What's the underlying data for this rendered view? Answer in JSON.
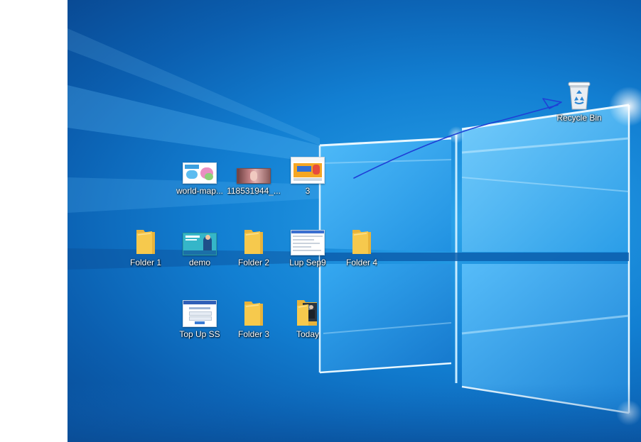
{
  "desktop": {
    "icons": [
      {
        "id": "recycle-bin",
        "label": "Recycle Bin"
      },
      {
        "id": "world-map",
        "label": "world-map..."
      },
      {
        "id": "photo-118531944",
        "label": "118531944_..."
      },
      {
        "id": "file-3",
        "label": "3"
      },
      {
        "id": "folder-1",
        "label": "Folder 1"
      },
      {
        "id": "demo",
        "label": "demo"
      },
      {
        "id": "folder-2",
        "label": "Folder 2"
      },
      {
        "id": "lup-sep9",
        "label": "Lup Sep9"
      },
      {
        "id": "folder-4",
        "label": "Folder 4"
      },
      {
        "id": "top-up-ss",
        "label": "Top Up SS"
      },
      {
        "id": "folder-3",
        "label": "Folder 3"
      },
      {
        "id": "today",
        "label": "Today"
      }
    ]
  },
  "colors": {
    "wallpaper_blue": "#127fd2",
    "annotation_stroke": "#1f3fd6",
    "folder_yellow": "#f6c94d"
  }
}
